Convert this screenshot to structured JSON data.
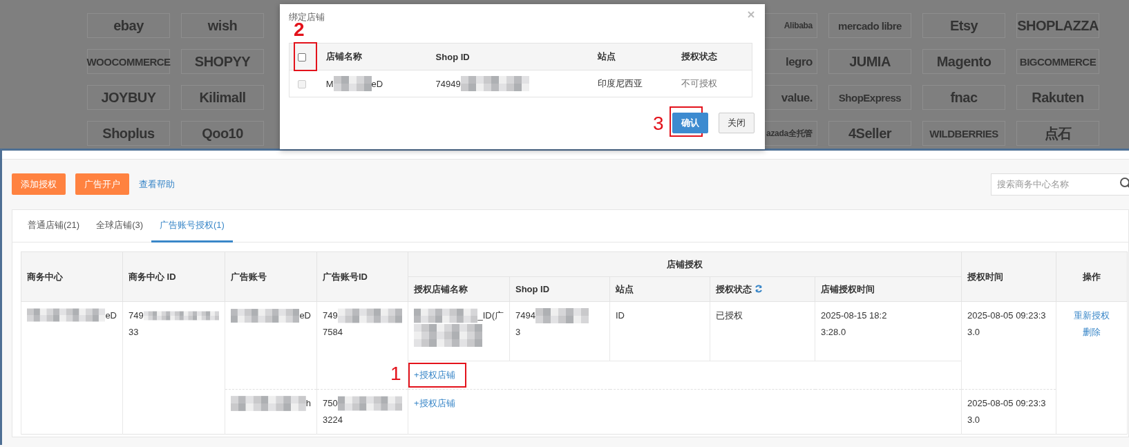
{
  "logo_board": {
    "left": [
      "ebay",
      "wish",
      "WOOCOMMERCE",
      "SHOPYY",
      "JOYBUY",
      "Kilimall",
      "Shoplus",
      "Qoo10"
    ],
    "right": [
      "Alibaba",
      "mercado libre",
      "Etsy",
      "SHOPLAZZA",
      "legro",
      "JUMIA",
      "Magento",
      "BIGCOMMERCE",
      "value.",
      "ShopExpress",
      "fnac",
      "Rakuten",
      "azada全托管",
      "4Seller",
      "WILDBERRIES",
      "点石"
    ]
  },
  "dialog": {
    "title": "绑定店铺",
    "select_all": {
      "checked": false,
      "annotation": "2"
    },
    "columns": [
      "店铺名称",
      "Shop ID",
      "站点",
      "授权状态"
    ],
    "rows": [
      {
        "checked": false,
        "disabled": true,
        "name": {
          "prefix": "M",
          "suffix": "eD"
        },
        "shop_id": {
          "prefix": "74949"
        },
        "site": "印度尼西亚",
        "status": "不可授权"
      }
    ],
    "buttons": [
      {
        "label": "确认",
        "kind": "primary",
        "annotation": "3"
      },
      {
        "label": "关闭",
        "kind": "default"
      }
    ]
  },
  "toolbar": {
    "buttons": [
      "添加授权",
      "广告开户"
    ],
    "help_link": "查看帮助",
    "search": {
      "placeholder": "搜索商务中心名称"
    }
  },
  "tabs": [
    {
      "label": "普通店铺(21)",
      "selected": false
    },
    {
      "label": "全球店铺(3)",
      "selected": false
    },
    {
      "label": "广告账号授权(1)",
      "selected": true
    }
  ],
  "table": {
    "columns": [
      "商务中心",
      "商务中心 ID",
      "广告账号",
      "广告账号ID"
    ],
    "group": {
      "label": "店铺授权",
      "columns": [
        "授权店铺名称",
        "Shop ID",
        "站点",
        "授权状态",
        "店铺授权时间"
      ]
    },
    "tail_columns": [
      "授权时间",
      "操作"
    ],
    "business_centers": [
      {
        "name": {
          "suffix": "eD"
        },
        "id": {
          "prefix": "749",
          "line2": "33"
        },
        "actions": [
          "重新授权",
          "删除"
        ],
        "ad_accounts": [
          {
            "name": {
              "suffix": "eD"
            },
            "id": {
              "prefix": "749",
              "line2": "7584"
            },
            "authorized_at": [
              "2025-08-05 09:23:3",
              "3.0"
            ],
            "shops": [
              {
                "name": {
                  "suffix": "_ID(广"
                },
                "shop_id": {
                  "prefix": "7494",
                  "line2": "3"
                },
                "site": "ID",
                "status": "已授权",
                "authorized_at": [
                  "2025-08-15 18:2",
                  "3:28.0"
                ]
              }
            ],
            "add_link": {
              "label": "+授权店铺",
              "annotation": "1"
            }
          },
          {
            "name": {
              "suffix": "h"
            },
            "id": {
              "prefix": "750",
              "line2": "3224"
            },
            "authorized_at": [
              "2025-08-05 09:23:3",
              "3.0"
            ],
            "add_link": {
              "label": "+授权店铺"
            }
          }
        ]
      }
    ]
  }
}
